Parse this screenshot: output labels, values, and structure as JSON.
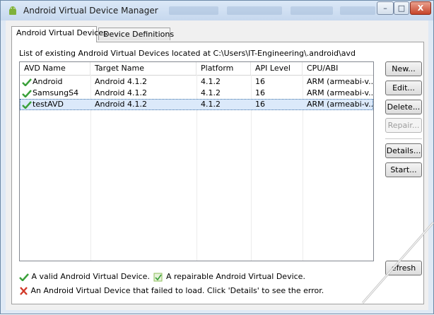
{
  "window": {
    "title": "Android Virtual Device Manager",
    "controls": {
      "minimize": "–",
      "maximize": "□",
      "close": "X"
    }
  },
  "tabs": [
    {
      "label": "Android Virtual Devices",
      "active": true
    },
    {
      "label": "Device Definitions",
      "active": false
    }
  ],
  "panel": {
    "description": "List of existing Android Virtual Devices located at C:\\Users\\IT-Engineering\\.android\\avd"
  },
  "table": {
    "headers": [
      "AVD Name",
      "Target Name",
      "Platform",
      "API Level",
      "CPU/ABI"
    ],
    "rows": [
      {
        "name": "Android",
        "target": "Android 4.1.2",
        "platform": "4.1.2",
        "api": "16",
        "cpu": "ARM (armeabi-v...",
        "status": "valid",
        "selected": false
      },
      {
        "name": "SamsungS4",
        "target": "Android 4.1.2",
        "platform": "4.1.2",
        "api": "16",
        "cpu": "ARM (armeabi-v...",
        "status": "valid",
        "selected": false
      },
      {
        "name": "testAVD",
        "target": "Android 4.1.2",
        "platform": "4.1.2",
        "api": "16",
        "cpu": "ARM (armeabi-v...",
        "status": "valid",
        "selected": true
      }
    ]
  },
  "buttons": {
    "new": "New...",
    "edit": "Edit...",
    "delete": "Delete...",
    "repair": "Repair...",
    "details": "Details...",
    "start": "Start...",
    "refresh": "efresh"
  },
  "legend": {
    "valid": "A valid Android Virtual Device.",
    "repairable": "A repairable Android Virtual Device.",
    "failed": "An Android Virtual Device that failed to load. Click 'Details' to see the error."
  },
  "icons": {
    "app": "android-icon",
    "valid": "green-check-icon",
    "repairable": "repair-icon",
    "failed": "red-x-icon"
  },
  "colors": {
    "valid": "#3aa03a",
    "failed": "#d23a2a",
    "selection": "#dbe9fa"
  }
}
